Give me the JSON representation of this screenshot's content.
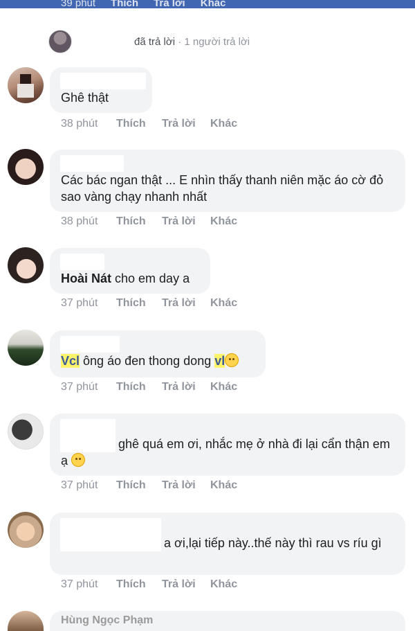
{
  "topbar": {
    "time": "39 phút",
    "like": "Thích",
    "reply": "Trả lời",
    "more": "Khác"
  },
  "reply_summary": {
    "label": "đã trả lời",
    "count": " · 1 người trả lời"
  },
  "comments": [
    {
      "text": "Ghê thật",
      "time": "38 phút",
      "like": "Thích",
      "reply": "Trả lời",
      "more": "Khác"
    },
    {
      "text": "Các bác ngan thật ... E nhìn thấy thanh niên mặc áo cờ đỏ sao vàng chạy nhanh nhất",
      "time": "38 phút",
      "like": "Thích",
      "reply": "Trả lời",
      "more": "Khác"
    },
    {
      "mention": "Hoài Nát",
      "text": " cho em day a",
      "time": "37 phút",
      "like": "Thích",
      "reply": "Trả lời",
      "more": "Khác"
    },
    {
      "prefix": "Vcl",
      "text": " ông áo đen thong dong ",
      "suffix": "vl",
      "time": "37 phút",
      "like": "Thích",
      "reply": "Trả lời",
      "more": "Khác"
    },
    {
      "text": "ghê quá em ơi, nhắc mẹ ở nhà đi lại cẩn thận em ạ",
      "time": "37 phút",
      "like": "Thích",
      "reply": "Trả lời",
      "more": "Khác"
    },
    {
      "text": "a ơi,lại tiếp này..thế này thì rau vs ríu gì",
      "time": "37 phút",
      "like": "Thích",
      "reply": "Trả lời",
      "more": "Khác"
    },
    {
      "name": "Hùng Ngọc Phạm"
    }
  ]
}
